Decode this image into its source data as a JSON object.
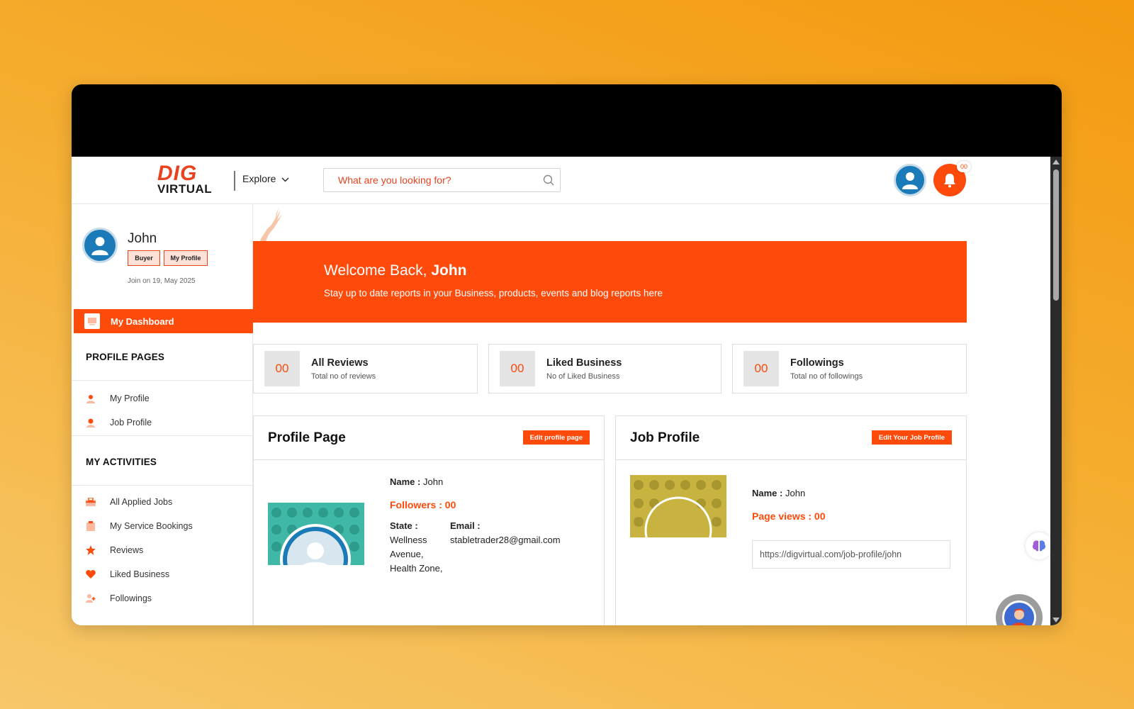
{
  "header": {
    "logo_top": "DIG",
    "logo_bottom": "VIRTUAL",
    "explore_label": "Explore",
    "search_placeholder": "What are you looking for?",
    "notification_count": "00"
  },
  "sidebar": {
    "user_name": "John",
    "role_chip": "Buyer",
    "profile_chip": "My Profile",
    "join_text": "Join on 19, May 2025",
    "active_item": "My Dashboard",
    "profile_pages_heading": "PROFILE PAGES",
    "profile_pages": [
      {
        "label": "My Profile"
      },
      {
        "label": "Job Profile"
      }
    ],
    "activities_heading": "MY ACTIVITIES",
    "activities": [
      {
        "label": "All Applied Jobs"
      },
      {
        "label": "My Service Bookings"
      },
      {
        "label": "Reviews"
      },
      {
        "label": "Liked Business"
      },
      {
        "label": "Followings"
      }
    ]
  },
  "banner": {
    "welcome_prefix": "Welcome Back,",
    "welcome_name": "John",
    "subtitle": "Stay up to date reports in your Business, products, events and blog reports here"
  },
  "stats": [
    {
      "value": "00",
      "title": "All Reviews",
      "subtitle": "Total no of reviews"
    },
    {
      "value": "00",
      "title": "Liked Business",
      "subtitle": "No of Liked Business"
    },
    {
      "value": "00",
      "title": "Followings",
      "subtitle": "Total no of followings"
    }
  ],
  "profile_card": {
    "title": "Profile Page",
    "button": "Edit profile page",
    "name_label": "Name :",
    "name_value": "John",
    "followers": "Followers : 00",
    "state_label": "State :",
    "state_value_1": "Wellness",
    "state_value_2": "Avenue,",
    "state_value_3": "Health Zone,",
    "email_label": "Email :",
    "email_value": "stabletrader28@gmail.com"
  },
  "job_card": {
    "title": "Job Profile",
    "button": "Edit Your Job Profile",
    "name_label": "Name :",
    "name_value": "John",
    "page_views": "Page views : 00",
    "url": "https://digvirtual.com/job-profile/john"
  },
  "colors": {
    "accent": "#fe4a0a",
    "avatar_blue": "#1b7bb8",
    "background_gradient_start": "#f39a10",
    "background_gradient_end": "#f7c76a"
  },
  "icons": [
    "search-icon",
    "chevron-down-icon",
    "bell-icon",
    "user-avatar-icon",
    "dashboard-icon",
    "brain-icon",
    "bot-icon"
  ]
}
